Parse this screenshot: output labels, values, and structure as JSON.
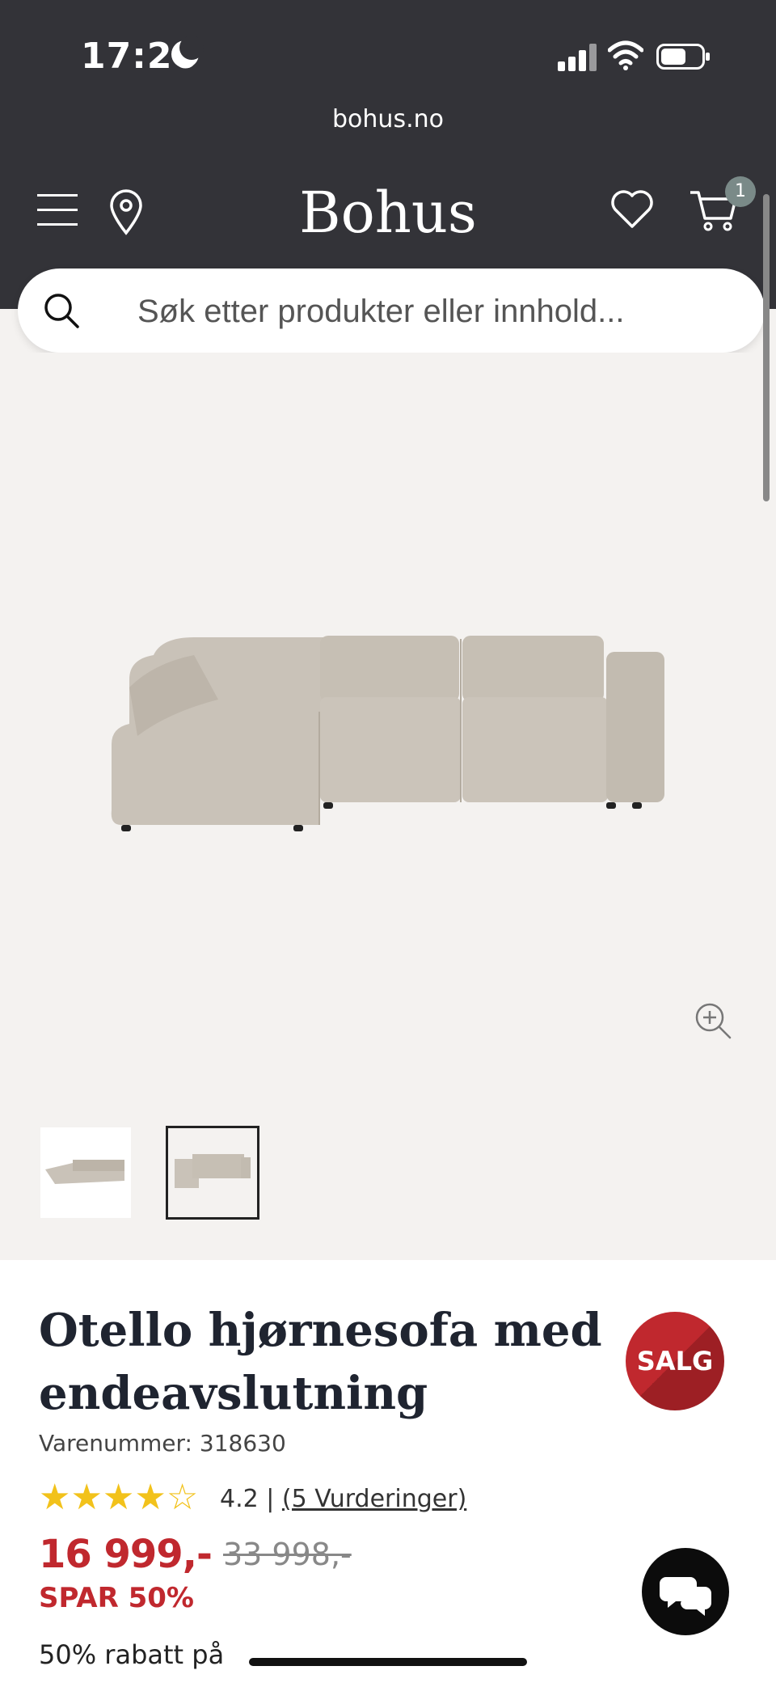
{
  "status": {
    "time": "17:26"
  },
  "browser": {
    "url": "bohus.no"
  },
  "header": {
    "logo": "Bohus",
    "cart_count": "1"
  },
  "search": {
    "placeholder": "Søk etter produkter eller innhold..."
  },
  "product": {
    "title": "Otello hjørnesofa med endeavslutning",
    "sale_badge": "SALG",
    "sku_label": "Varenummer: 318630",
    "rating_value": "4.2",
    "rating_separator": "|",
    "reviews_link": "(5 Vurderinger)",
    "rating_stars": 4.2,
    "price": "16 999,-",
    "old_price": "33 998,-",
    "savings": "SPAR 50%",
    "promo_text": "50% rabatt på"
  },
  "gallery": {
    "thumbnails": 2,
    "selected_thumbnail": 2
  },
  "colors": {
    "header_bg": "#333338",
    "sale_red": "#c0282e",
    "star_yellow": "#f2c21b",
    "sofa_fabric": "#c9c2b8"
  },
  "icons": [
    "moon-icon",
    "signal-icon",
    "wifi-icon",
    "battery-icon",
    "menu-icon",
    "location-pin-icon",
    "heart-icon",
    "cart-icon",
    "search-icon",
    "zoom-in-icon",
    "star-icon",
    "chat-icon"
  ]
}
